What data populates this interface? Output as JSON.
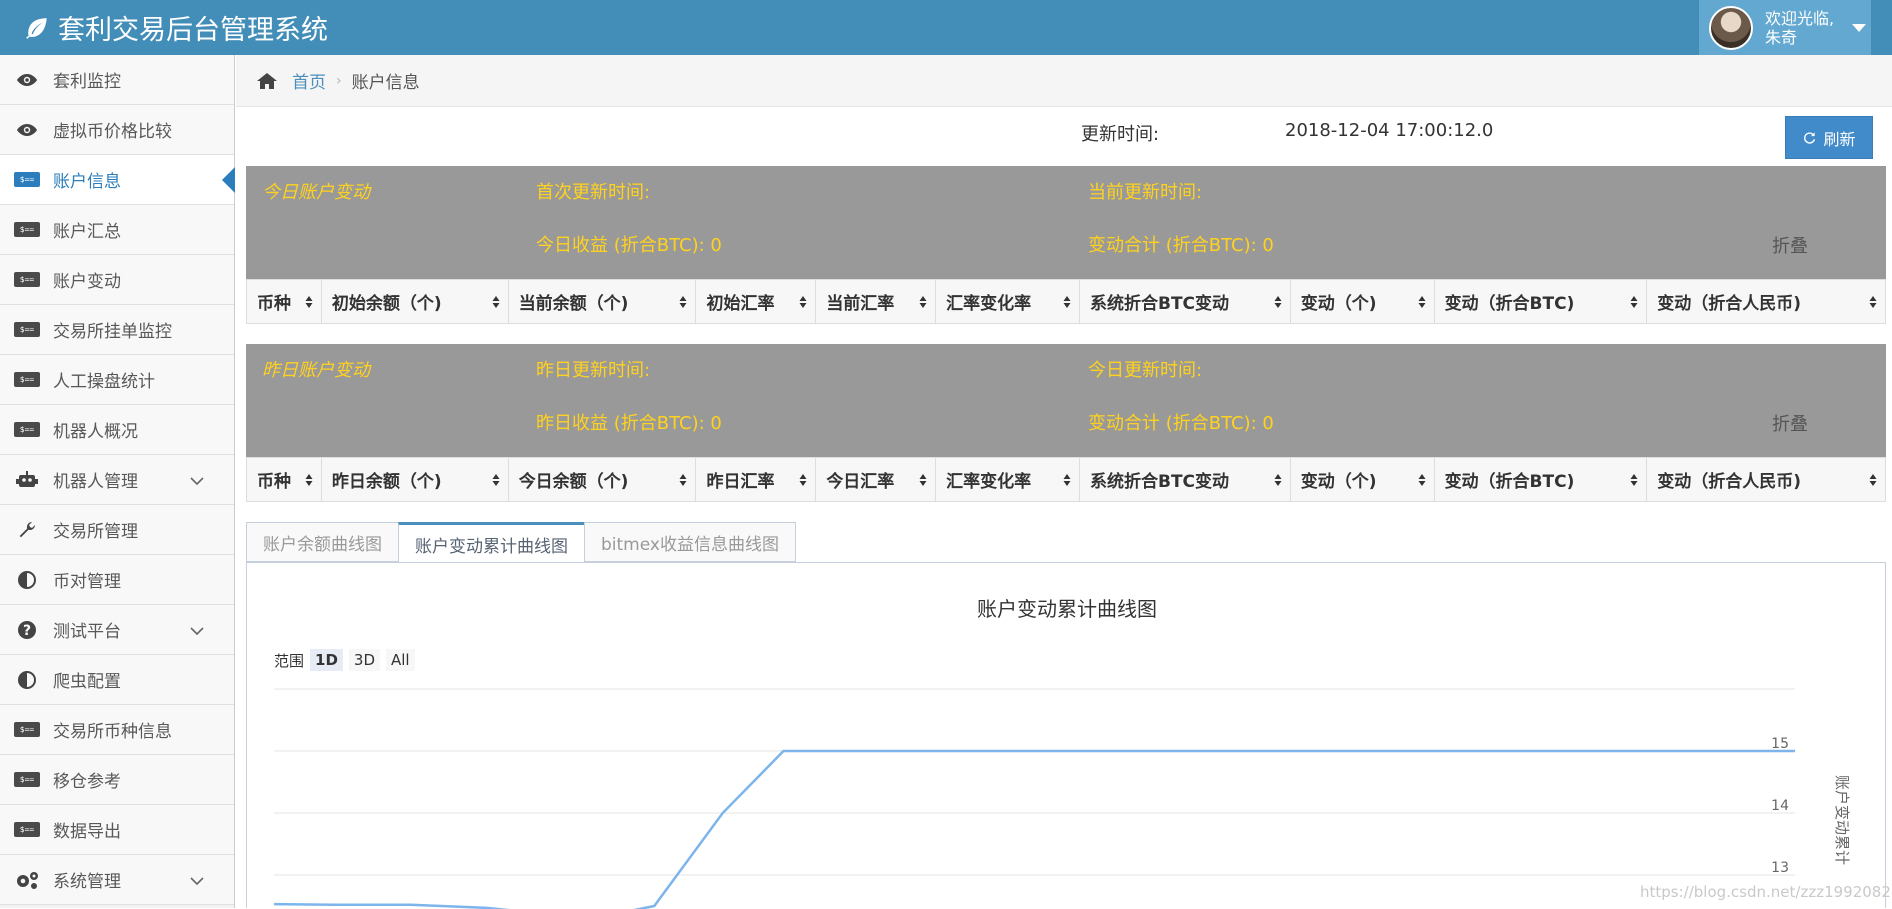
{
  "header": {
    "title": "套利交易后台管理系统",
    "welcome": "欢迎光临,",
    "username": "朱奇"
  },
  "sidebar": {
    "items": [
      {
        "label": "套利监控",
        "icon": "eye-icon"
      },
      {
        "label": "虚拟币价格比较",
        "icon": "eye-icon"
      },
      {
        "label": "账户信息",
        "icon": "money-icon",
        "active": true
      },
      {
        "label": "账户汇总",
        "icon": "money-icon"
      },
      {
        "label": "账户变动",
        "icon": "money-icon"
      },
      {
        "label": "交易所挂单监控",
        "icon": "money-icon"
      },
      {
        "label": "人工操盘统计",
        "icon": "money-icon"
      },
      {
        "label": "机器人概况",
        "icon": "money-icon"
      },
      {
        "label": "机器人管理",
        "icon": "robot-icon",
        "expandable": true
      },
      {
        "label": "交易所管理",
        "icon": "wrench-icon"
      },
      {
        "label": "币对管理",
        "icon": "adjust-icon"
      },
      {
        "label": "测试平台",
        "icon": "question-icon",
        "expandable": true
      },
      {
        "label": "爬虫配置",
        "icon": "adjust-icon"
      },
      {
        "label": "交易所币种信息",
        "icon": "money-icon"
      },
      {
        "label": "移仓参考",
        "icon": "money-icon"
      },
      {
        "label": "数据导出",
        "icon": "money-icon"
      },
      {
        "label": "系统管理",
        "icon": "gears-icon",
        "expandable": true
      }
    ]
  },
  "breadcrumb": {
    "home": "首页",
    "current": "账户信息"
  },
  "update": {
    "label": "更新时间:",
    "value": "2018-12-04 17:00:12.0",
    "refresh": "刷新"
  },
  "today": {
    "title": "今日账户变动",
    "first_time": "首次更新时间:",
    "current_time": "当前更新时间:",
    "income": "今日收益 (折合BTC):  0",
    "total": "变动合计 (折合BTC):  0",
    "fold": "折叠",
    "columns": [
      "币种",
      "初始余额（个)",
      "当前余额（个)",
      "初始汇率",
      "当前汇率",
      "汇率变化率",
      "系统折合BTC变动",
      "变动（个)",
      "变动（折合BTC)",
      "变动（折合人民币)"
    ]
  },
  "yesterday": {
    "title": "昨日账户变动",
    "first_time": "昨日更新时间:",
    "current_time": "今日更新时间:",
    "income": "昨日收益 (折合BTC):  0",
    "total": "变动合计 (折合BTC):  0",
    "fold": "折叠",
    "columns": [
      "币种",
      "昨日余额（个)",
      "今日余额（个)",
      "昨日汇率",
      "今日汇率",
      "汇率变化率",
      "系统折合BTC变动",
      "变动（个)",
      "变动（折合BTC)",
      "变动（折合人民币)"
    ]
  },
  "tabs": [
    {
      "label": "账户余额曲线图"
    },
    {
      "label": "账户变动累计曲线图",
      "active": true
    },
    {
      "label": "bitmex收益信息曲线图"
    }
  ],
  "chart_controls": {
    "range_label": "范围",
    "buttons": [
      "1D",
      "3D",
      "All"
    ],
    "selected": "1D"
  },
  "chart_data": {
    "type": "line",
    "title": "账户变动累计曲线图",
    "ylabel": "账户变动累计",
    "yticks": [
      13,
      14,
      15
    ],
    "ylim": [
      12.5,
      16
    ],
    "xlim": [
      0,
      100
    ],
    "series": [
      {
        "color": "#7cb5ec",
        "x": [
          0,
          4,
          9,
          14,
          21,
          25,
          29.5,
          33.5,
          40,
          60,
          80,
          100
        ],
        "y": [
          12.53,
          12.52,
          12.52,
          12.47,
          12.3,
          12.5,
          14.0,
          15.0,
          15.0,
          15.0,
          15.0,
          15.0
        ]
      }
    ]
  },
  "watermark": "https://blog.csdn.net/zzz19920821"
}
